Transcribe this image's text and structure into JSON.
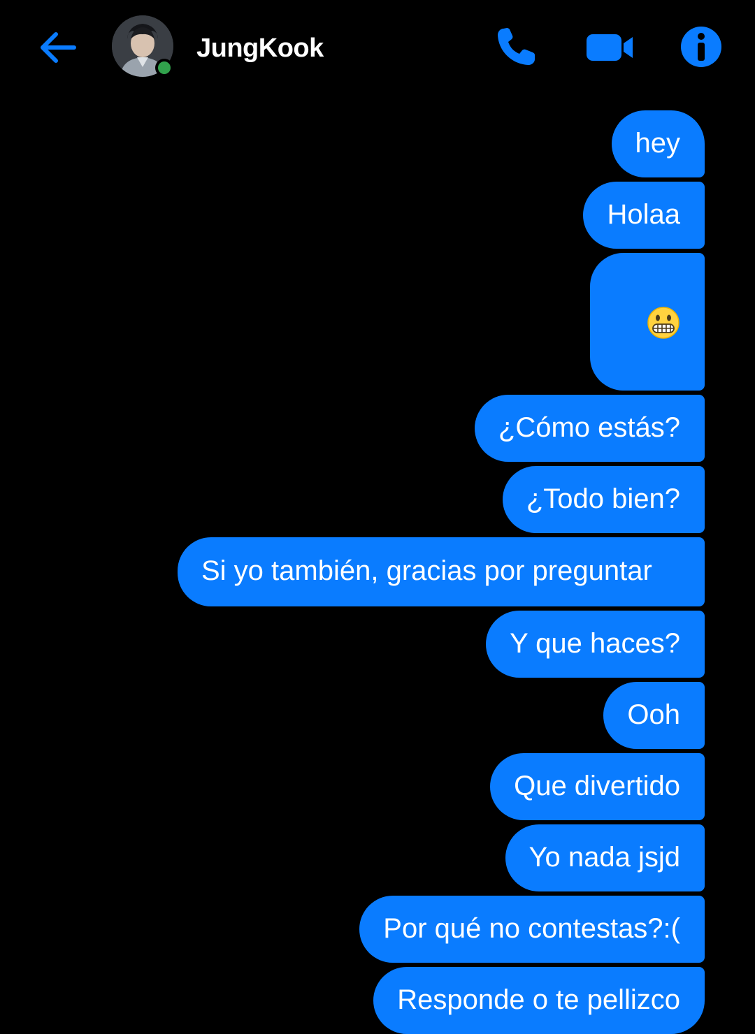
{
  "header": {
    "contact_name": "JungKook",
    "online": true,
    "accent_color": "#0a7cff",
    "status_color": "#31a24c",
    "back_icon": "arrow-left-icon",
    "actions": [
      "phone-icon",
      "video-camera-icon",
      "info-icon"
    ]
  },
  "messages": [
    {
      "text": "hey"
    },
    {
      "text": "Holaa"
    },
    {
      "text": "",
      "emoji": "grimacing-face-emoji"
    },
    {
      "text": "¿Cómo estás?"
    },
    {
      "text": "¿Todo bien?"
    },
    {
      "text": "Si yo también, gracias por preguntar"
    },
    {
      "text": "Y que haces?"
    },
    {
      "text": "Ooh"
    },
    {
      "text": "Que divertido"
    },
    {
      "text": "Yo nada jsjd"
    },
    {
      "text": "Por qué no contestas?:("
    },
    {
      "text": "Responde o te pellizco"
    }
  ]
}
